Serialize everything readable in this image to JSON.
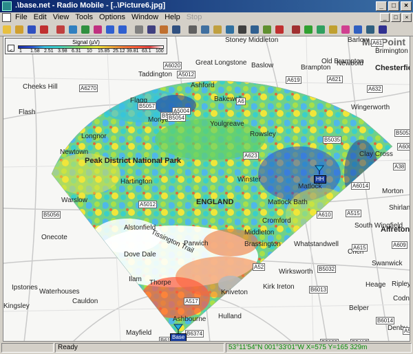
{
  "window": {
    "title": ".\\base.net - Radio Mobile - [..\\Picture6.jpg]",
    "buttons": [
      "_",
      "□",
      "×"
    ]
  },
  "menubar": {
    "items": [
      "File",
      "Edit",
      "View",
      "Tools",
      "Options",
      "Window",
      "Help",
      "Stop"
    ],
    "mdi_buttons": [
      "_",
      "□",
      "×"
    ]
  },
  "toolbar": {
    "icons": [
      "new-icon",
      "open-icon",
      "save-icon",
      "scissors-icon",
      "antenna-icon",
      "globe-icon",
      "net-icon",
      "radio-icon",
      "back-arrow-icon",
      "forward-arrow-icon",
      "window-icon",
      "copy-icon",
      "picture-icon",
      "save-picture-icon",
      "print-icon",
      "merge-icon",
      "paste-icon",
      "image-icon",
      "zoom-icon",
      "select-icon",
      "crop-icon",
      "clear-icon",
      "link-icon",
      "green-circle-icon",
      "target-icon",
      "coverage-icon",
      "rainbow-icon",
      "color-icon",
      "chart-icon",
      "spectrum-icon"
    ]
  },
  "legend": {
    "title": "Signal (µV)",
    "ticks": [
      "<",
      "1",
      "1.58",
      "2.51",
      "3.98",
      "6.31",
      "10",
      "15.85",
      "25.12",
      "39.81",
      "63.1",
      "100"
    ]
  },
  "map": {
    "brand": "MapPoint",
    "places": [
      {
        "name": "Taddington"
      },
      {
        "name": "Cheeks Hill"
      },
      {
        "name": "Flash"
      },
      {
        "name": "Flagg"
      },
      {
        "name": "Monyash"
      },
      {
        "name": "Ashford"
      },
      {
        "name": "Bakewell"
      },
      {
        "name": "Great Longstone"
      },
      {
        "name": "Stoney Middleton"
      },
      {
        "name": "Baslow"
      },
      {
        "name": "Barlow"
      },
      {
        "name": "Old Brampton"
      },
      {
        "name": "Brampton"
      },
      {
        "name": "Newbold"
      },
      {
        "name": "Brimington"
      },
      {
        "name": "Chesterfield"
      },
      {
        "name": "Wingerworth"
      },
      {
        "name": "Longnor"
      },
      {
        "name": "Newtown"
      },
      {
        "name": "Youlgreave"
      },
      {
        "name": "Rowsley"
      },
      {
        "name": "Peak District National Park"
      },
      {
        "name": "Hartington"
      },
      {
        "name": "Winster"
      },
      {
        "name": "Matlock"
      },
      {
        "name": "Clay Cross"
      },
      {
        "name": "Shirland"
      },
      {
        "name": "Morton"
      },
      {
        "name": "Warslow"
      },
      {
        "name": "ENGLAND"
      },
      {
        "name": "Matlock Bath"
      },
      {
        "name": "Cromford"
      },
      {
        "name": "Alstonfield"
      },
      {
        "name": "South Wingfield"
      },
      {
        "name": "Alfreton"
      },
      {
        "name": "Onecote"
      },
      {
        "name": "Parwich"
      },
      {
        "name": "Middleton"
      },
      {
        "name": "Brassington"
      },
      {
        "name": "Whatstandwell"
      },
      {
        "name": "Crich"
      },
      {
        "name": "Swanwick"
      },
      {
        "name": "Dove Dale"
      },
      {
        "name": "Wirksworth"
      },
      {
        "name": "Ipstones"
      },
      {
        "name": "Waterhouses"
      },
      {
        "name": "Ilam"
      },
      {
        "name": "Thorpe"
      },
      {
        "name": "Kniveton"
      },
      {
        "name": "Kirk Ireton"
      },
      {
        "name": "Heage"
      },
      {
        "name": "Ripley"
      },
      {
        "name": "Codnor"
      },
      {
        "name": "Cauldon"
      },
      {
        "name": "Belper"
      },
      {
        "name": "Kingsley"
      },
      {
        "name": "Ashbourne"
      },
      {
        "name": "Hulland"
      },
      {
        "name": "Mayfield"
      },
      {
        "name": "Denby"
      },
      {
        "name": "Tissington Trail"
      }
    ],
    "roads": [
      "A6",
      "A619",
      "A621",
      "A632",
      "A61",
      "A5012",
      "A515",
      "A6020",
      "A5004",
      "B5055",
      "B5057",
      "A623",
      "A6270",
      "B5054",
      "B5056",
      "A5012",
      "B5035",
      "A6014",
      "A610",
      "A609",
      "B6013",
      "B5023",
      "A615",
      "A52",
      "B5032",
      "A517",
      "B6179",
      "B6374",
      "A38",
      "A6007",
      "B6014",
      "B5417",
      "B5053",
      "A523"
    ],
    "sites": [
      {
        "label": "HH"
      },
      {
        "label": "Base"
      }
    ]
  },
  "statusbar": {
    "ready": "Ready",
    "coords": "53°11'54\"N 001°33'01\"W  X=575 Y=165 329m"
  },
  "colors": {
    "titlebar_start": "#0a246a",
    "titlebar_end": "#3a6ea5",
    "status_coord": "#0a8a0a"
  }
}
